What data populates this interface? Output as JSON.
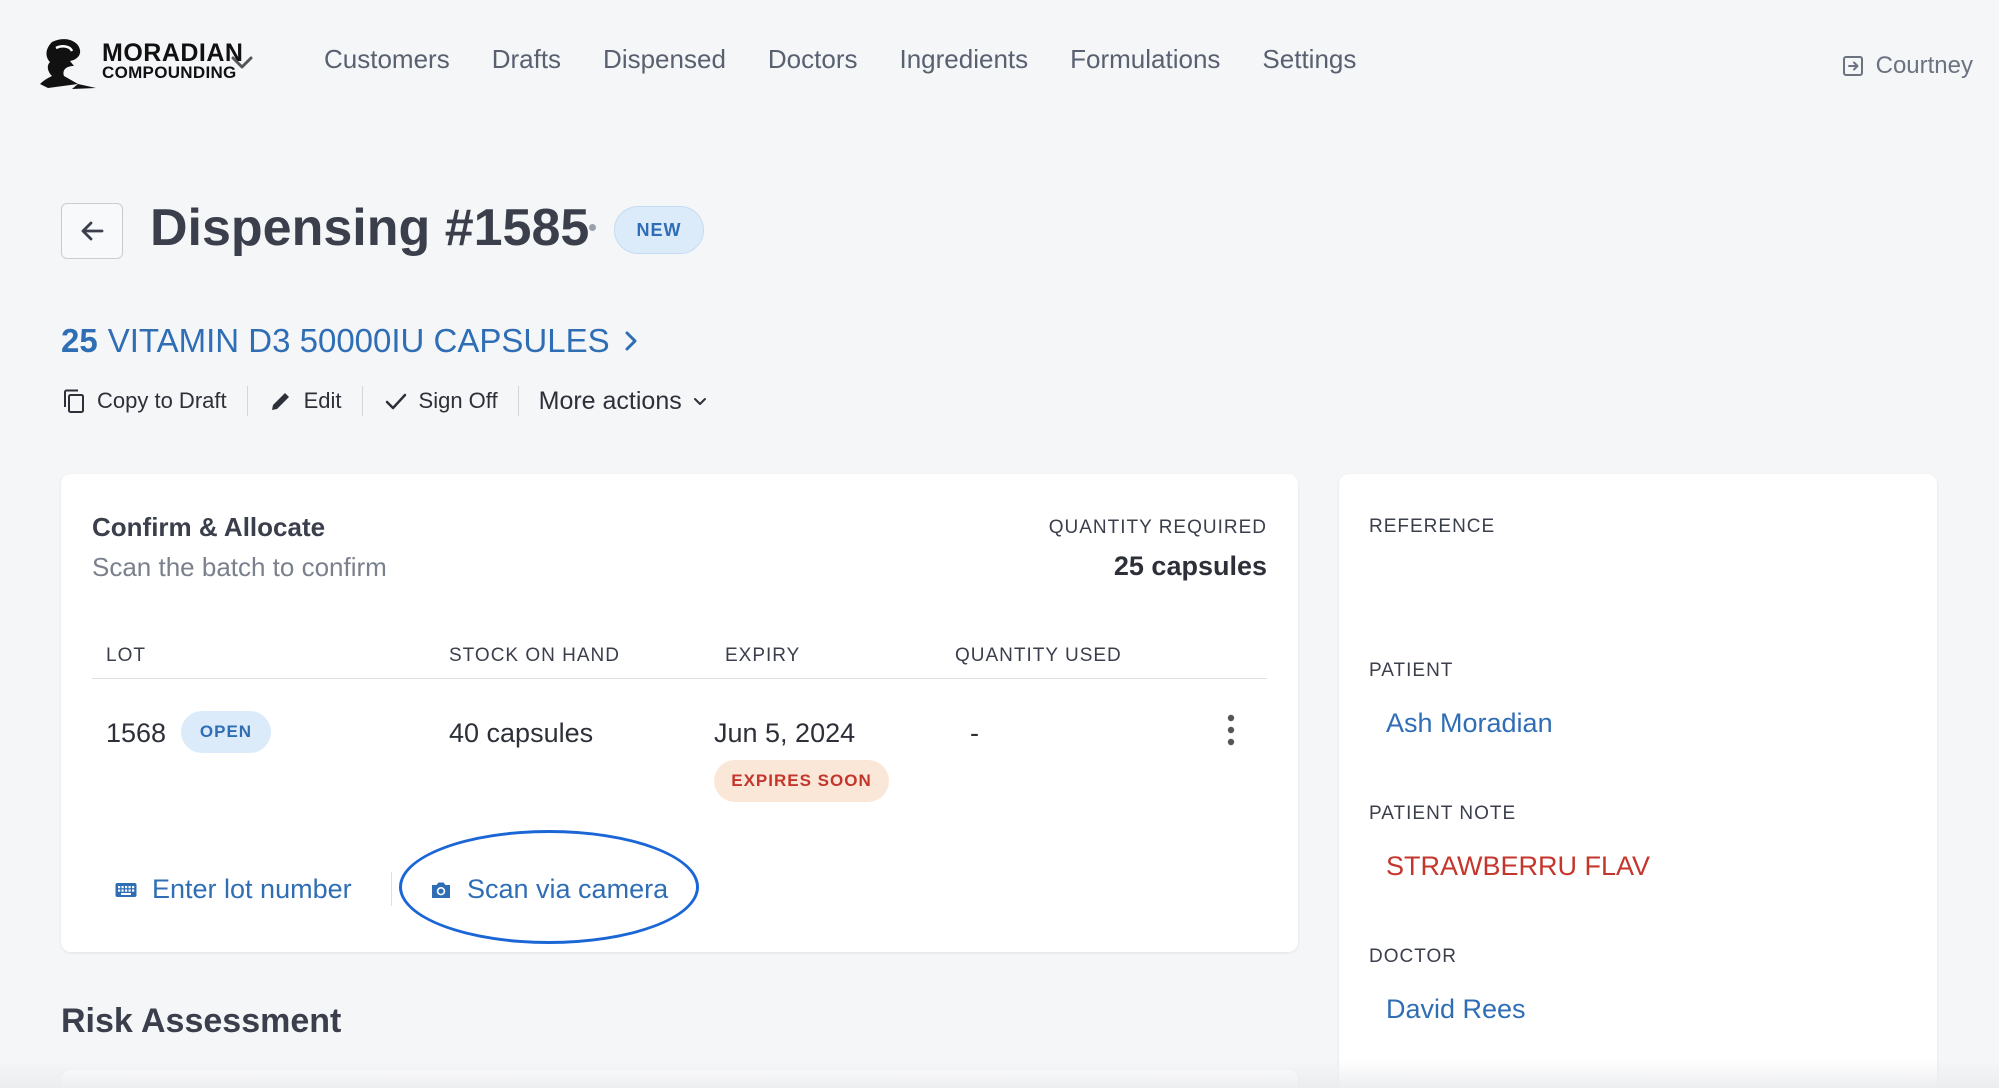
{
  "brand": {
    "line1": "MORADIAN",
    "line2": "COMPOUNDING"
  },
  "nav": {
    "items": [
      {
        "label": "Customers"
      },
      {
        "label": "Drafts"
      },
      {
        "label": "Dispensed"
      },
      {
        "label": "Doctors"
      },
      {
        "label": "Ingredients"
      },
      {
        "label": "Formulations"
      },
      {
        "label": "Settings"
      }
    ],
    "user": "Courtney"
  },
  "header": {
    "title": "Dispensing #1585",
    "status_badge": "NEW"
  },
  "product": {
    "quantity": "25",
    "name": "VITAMIN D3 50000IU CAPSULES"
  },
  "actions": {
    "copy_to_draft": "Copy to Draft",
    "edit": "Edit",
    "sign_off": "Sign Off",
    "more_actions": "More actions"
  },
  "confirm": {
    "title": "Confirm & Allocate",
    "subtitle": "Scan the batch to confirm",
    "quantity_required_label": "QUANTITY REQUIRED",
    "quantity_required_value": "25 capsules",
    "columns": {
      "lot": "LOT",
      "stock": "STOCK ON HAND",
      "expiry": "EXPIRY",
      "quantity_used": "QUANTITY USED"
    },
    "row": {
      "lot": "1568",
      "lot_badge": "OPEN",
      "stock": "40 capsules",
      "expiry": "Jun 5, 2024",
      "expiry_badge": "EXPIRES SOON",
      "quantity_used": "-"
    },
    "enter_lot": "Enter lot number",
    "scan_camera": "Scan via camera"
  },
  "risk": {
    "title": "Risk Assessment"
  },
  "side": {
    "reference_label": "REFERENCE",
    "patient_label": "PATIENT",
    "patient_value": "Ash Moradian",
    "patient_note_label": "PATIENT NOTE",
    "patient_note_value": "STRAWBERRU FLAV",
    "doctor_label": "DOCTOR",
    "doctor_value": "David Rees"
  },
  "colors": {
    "link": "#2f6eb5",
    "danger": "#c4362b",
    "badge_blue_bg": "#dcebfa",
    "badge_warn_bg": "#fbe7d8",
    "highlight_ring": "#1a66d6"
  }
}
